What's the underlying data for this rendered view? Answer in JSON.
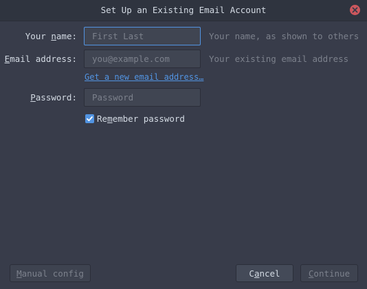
{
  "window": {
    "title": "Set Up an Existing Email Account"
  },
  "form": {
    "name": {
      "label_pre": "Your ",
      "label_u": "n",
      "label_post": "ame:",
      "placeholder": "First Last",
      "hint": "Your name, as shown to others"
    },
    "email": {
      "label_pre": "",
      "label_u": "E",
      "label_post": "mail address:",
      "placeholder": "you@example.com",
      "hint": "Your existing email address"
    },
    "new_email_link": "Get a new email address…",
    "password": {
      "label_pre": "",
      "label_u": "P",
      "label_post": "assword:",
      "placeholder": "Password"
    },
    "remember": {
      "label_pre": "Re",
      "label_u": "m",
      "label_post": "ember password",
      "checked": true
    }
  },
  "buttons": {
    "manual": {
      "pre": "",
      "u": "M",
      "post": "anual config"
    },
    "cancel": {
      "pre": "C",
      "u": "a",
      "post": "ncel"
    },
    "continue": {
      "pre": "",
      "u": "C",
      "post": "ontinue"
    }
  },
  "colors": {
    "accent": "#5294e2",
    "close": "#cc575d",
    "background": "#383c4a"
  },
  "icons": {
    "close": "close-icon",
    "check": "check-icon"
  }
}
